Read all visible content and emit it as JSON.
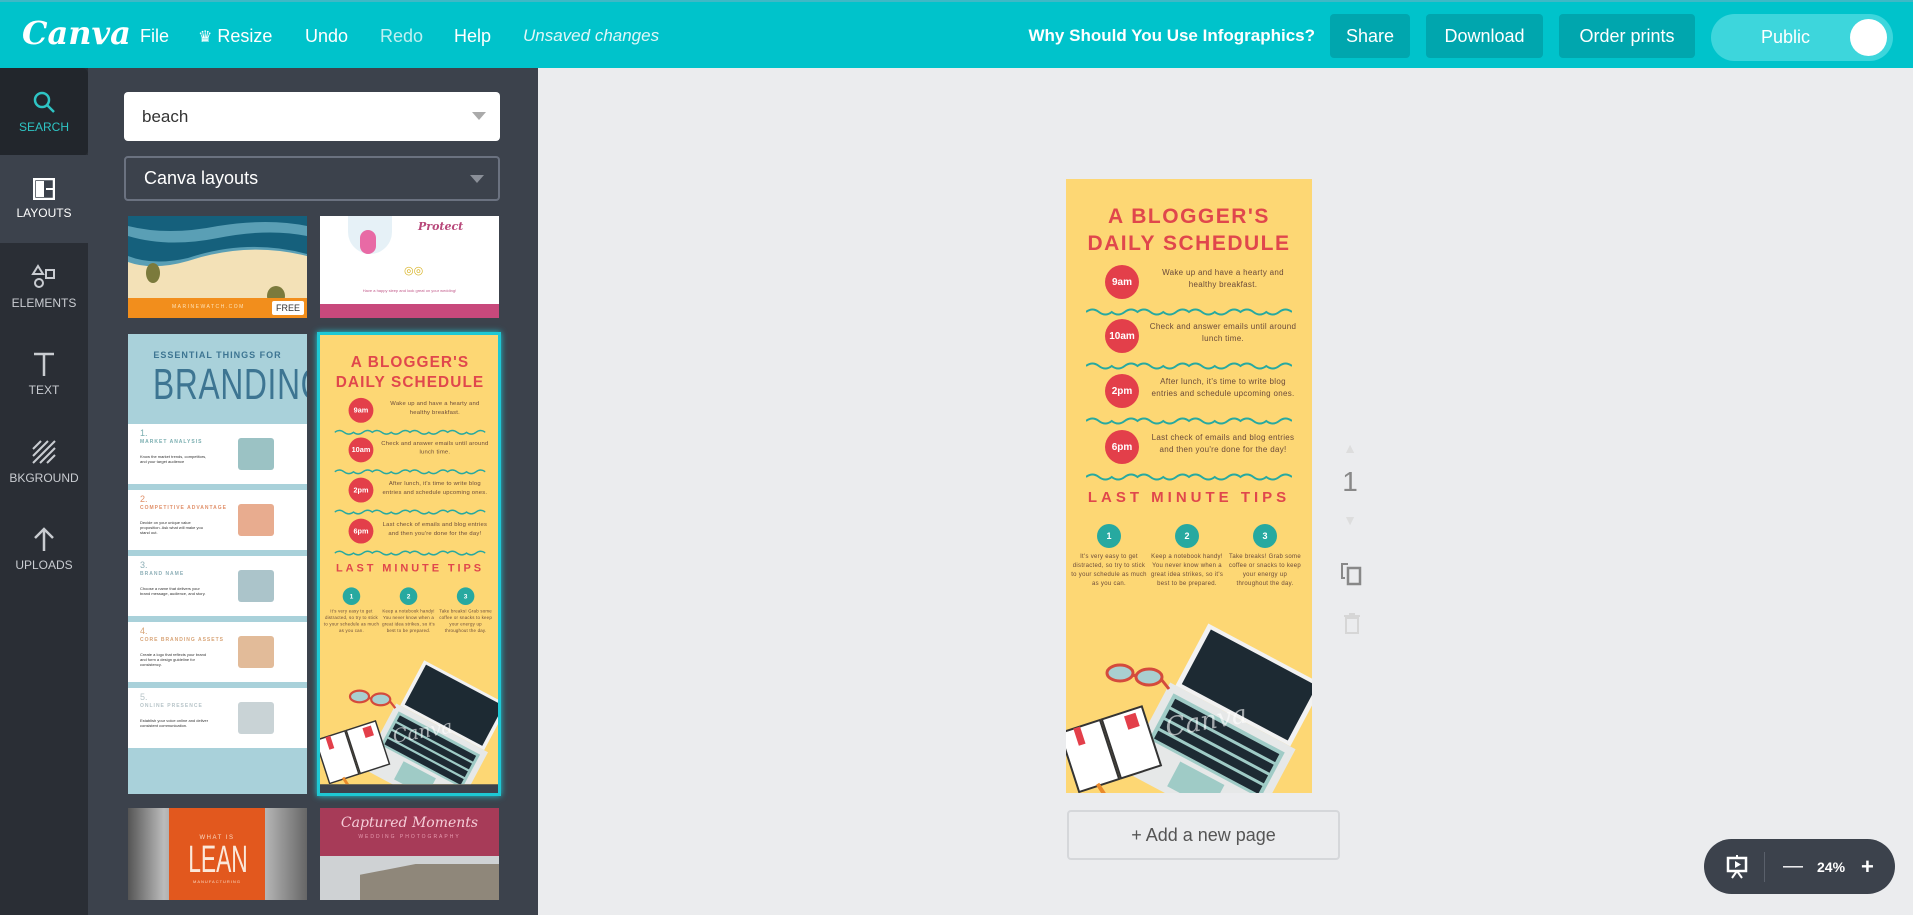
{
  "topbar": {
    "logo": "Canva",
    "menu": {
      "file": "File",
      "resize": "Resize",
      "undo": "Undo",
      "redo": "Redo",
      "help": "Help"
    },
    "status": "Unsaved changes",
    "design_title": "Why Should You Use Infographics?",
    "share": "Share",
    "download": "Download",
    "order_prints": "Order prints",
    "visibility": "Public",
    "visibility_on": true
  },
  "rail": {
    "items": [
      {
        "label": "SEARCH",
        "icon": "search-icon"
      },
      {
        "label": "LAYOUTS",
        "icon": "layouts-icon"
      },
      {
        "label": "ELEMENTS",
        "icon": "shapes-icon"
      },
      {
        "label": "TEXT",
        "icon": "text-icon"
      },
      {
        "label": "BKGROUND",
        "icon": "background-icon"
      },
      {
        "label": "UPLOADS",
        "icon": "upload-icon"
      }
    ],
    "active": "LAYOUTS"
  },
  "panel": {
    "search_value": "beach",
    "filter_value": "Canva layouts",
    "thumbs": {
      "beach": {
        "site": "MARINEWATCH.COM",
        "badge": "FREE"
      },
      "protect": {
        "title": "Protect",
        "caption": "Have a happy sleep and look great on your wedding!"
      },
      "branding": {
        "kicker": "ESSENTIAL THINGS FOR",
        "title": "BRANDING",
        "items": [
          {
            "num": "1.",
            "head": "MARKET ANALYSIS",
            "text": "Know the market trends, competitors, and your target audience"
          },
          {
            "num": "2.",
            "head": "COMPETITIVE ADVANTAGE",
            "text": "Decide on your unique value proposition. Ask what will make you stand out."
          },
          {
            "num": "3.",
            "head": "BRAND NAME",
            "text": "Choose a name that delivers your brand message, audience, and story."
          },
          {
            "num": "4.",
            "head": "CORE BRANDING ASSETS",
            "text": "Create a logo that reflects your brand and form a design guideline for consistency."
          },
          {
            "num": "5.",
            "head": "ONLINE PRESENCE",
            "text": "Establish your voice online and deliver consistent communication."
          }
        ]
      },
      "lean": {
        "kicker": "WHAT IS",
        "title": "LEAN",
        "sub": "MANUFACTURING"
      },
      "wedding": {
        "title": "Captured Moments",
        "sub": "WEDDING PHOTOGRAPHY"
      }
    }
  },
  "design": {
    "title_line1": "A BLOGGER'S",
    "title_line2": "DAILY SCHEDULE",
    "schedule": [
      {
        "time": "9am",
        "text": "Wake up and have a hearty and healthy breakfast."
      },
      {
        "time": "10am",
        "text": "Check and answer emails until around lunch time."
      },
      {
        "time": "2pm",
        "text": "After lunch, it's time to write blog entries and schedule upcoming ones."
      },
      {
        "time": "6pm",
        "text": "Last check of emails and blog entries and then you're done for the day!"
      }
    ],
    "tips_title": "LAST MINUTE TIPS",
    "tips": [
      {
        "num": "1",
        "text": "It's very easy to get distracted, so try to stick to your schedule as much as you can."
      },
      {
        "num": "2",
        "text": "Keep a notebook handy! You never know when a great idea strikes, so it's best to be prepared."
      },
      {
        "num": "3",
        "text": "Take breaks! Grab some coffee or snacks to keep your energy up throughout the day."
      }
    ],
    "watermark": "Canva",
    "colors": {
      "background": "#fdd774",
      "accent_red": "#e33f4a",
      "teal": "#27a9a0"
    }
  },
  "canvas": {
    "add_page": "+ Add a new page",
    "page_number": "1",
    "zoom": "24%"
  },
  "colors": {
    "brand": "#00c3cb",
    "panel": "#3c424c",
    "rail": "#2a2e35",
    "selected_border": "#1ec8d4"
  }
}
